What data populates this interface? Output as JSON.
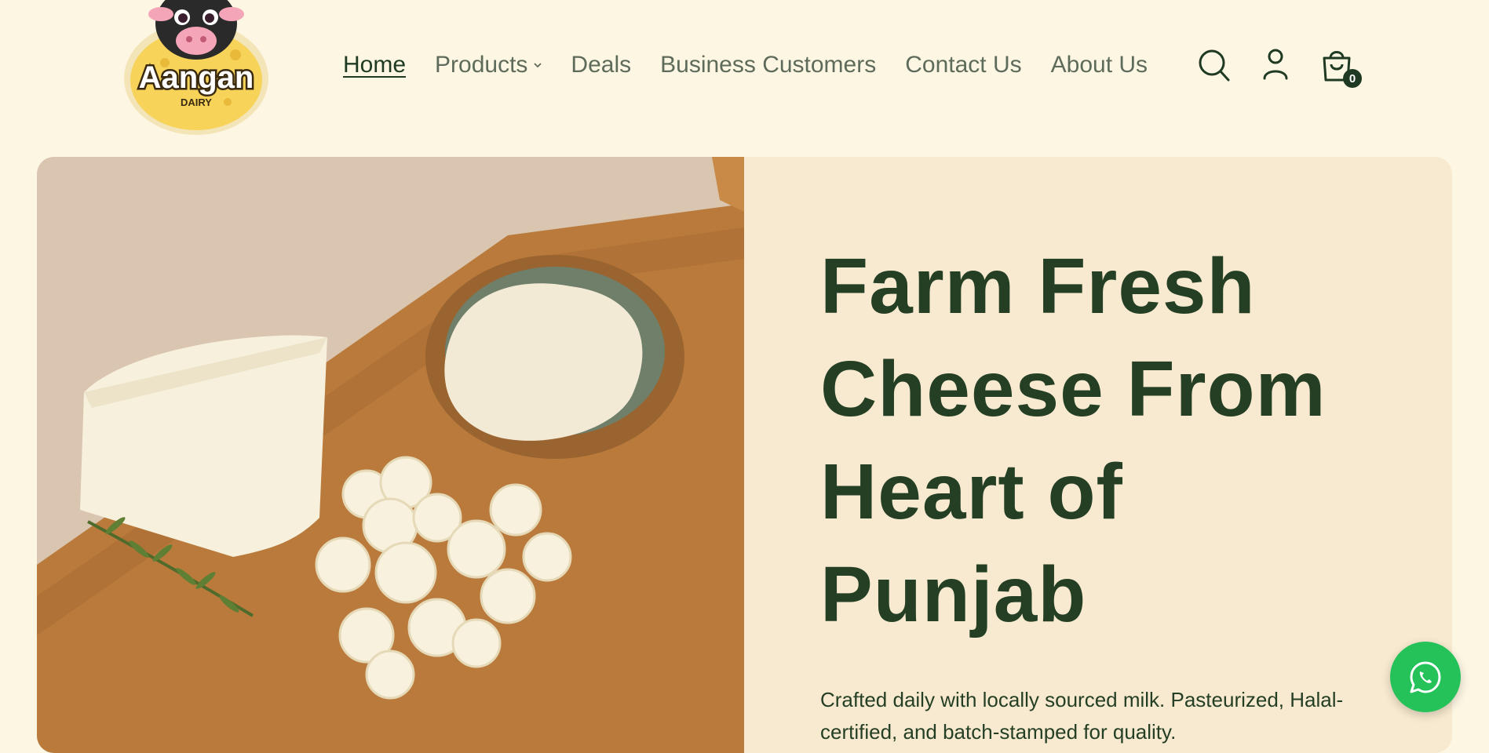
{
  "brand": {
    "name": "Aangan",
    "tagline": "DAIRY"
  },
  "nav": {
    "items": [
      {
        "label": "Home"
      },
      {
        "label": "Products"
      },
      {
        "label": "Deals"
      },
      {
        "label": "Business Customers"
      },
      {
        "label": "Contact Us"
      },
      {
        "label": "About Us"
      }
    ]
  },
  "header_icons": {
    "search": "search-icon",
    "account": "user-icon",
    "cart": "shopping-bag-icon",
    "cart_count": "0"
  },
  "hero": {
    "title_lines": [
      "Farm Fresh",
      "Cheese From",
      "Heart of",
      "Punjab"
    ],
    "subtitle": "Crafted daily with locally sourced milk. Pasteurized, Halal-certified, and batch-stamped for quality."
  },
  "floating": {
    "whatsapp": "whatsapp-icon"
  },
  "colors": {
    "background": "#fdf6e3",
    "hero_panel": "#f8ead0",
    "primary_text": "#243f24",
    "nav_text": "#5e6b5a",
    "whatsapp": "#25c25a"
  }
}
